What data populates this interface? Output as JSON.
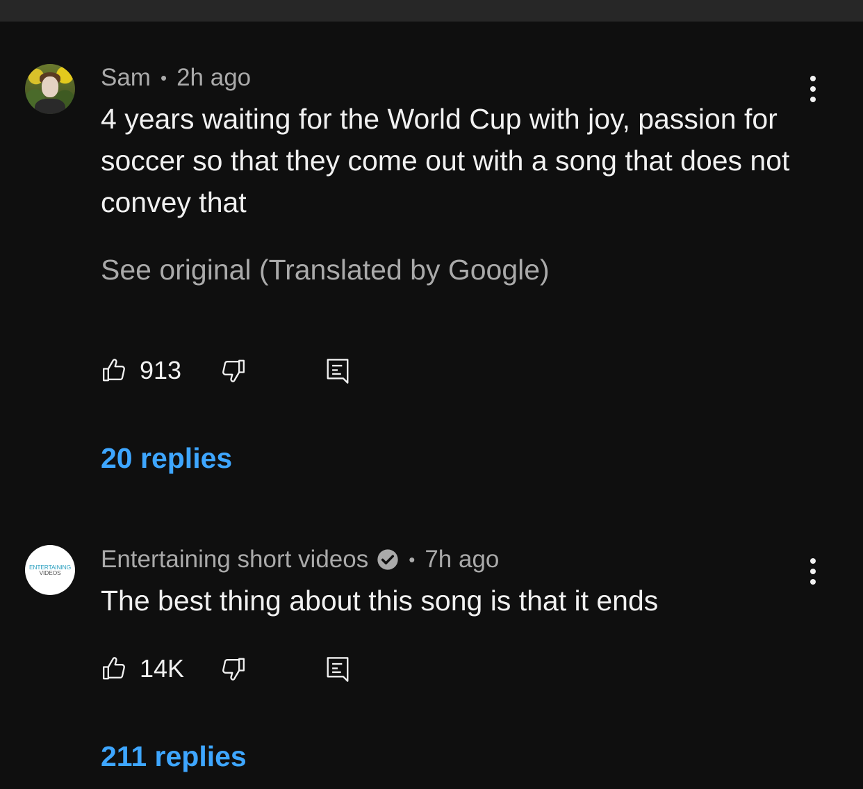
{
  "comments": [
    {
      "author": "Sam",
      "separator": "•",
      "time": "2h ago",
      "text": "4 years waiting for the World Cup with joy, passion for soccer so that they come out with a song that does not convey that",
      "translate_link": "See original (Translated by Google)",
      "likes": "913",
      "replies": "20 replies",
      "avatar_icon": "user-photo-avatar"
    },
    {
      "author": "Entertaining short videos",
      "separator": "•",
      "time": "7h ago",
      "verified": true,
      "text": "The best thing about this song is that it ends",
      "likes": "14K",
      "replies": "211 replies",
      "avatar_logo": {
        "line1": "ENTERTAINING",
        "line2": "VIDEOS"
      }
    }
  ],
  "colors": {
    "background": "#0f0f0f",
    "top_bar": "#272727",
    "primary_text": "#f1f1f1",
    "secondary_text": "#aaaaaa",
    "link_blue": "#3ea6ff"
  },
  "icons": {
    "like": "thumbs-up-icon",
    "dislike": "thumbs-down-icon",
    "reply": "reply-icon",
    "more": "more-vertical-icon",
    "verified": "verified-check-icon"
  }
}
